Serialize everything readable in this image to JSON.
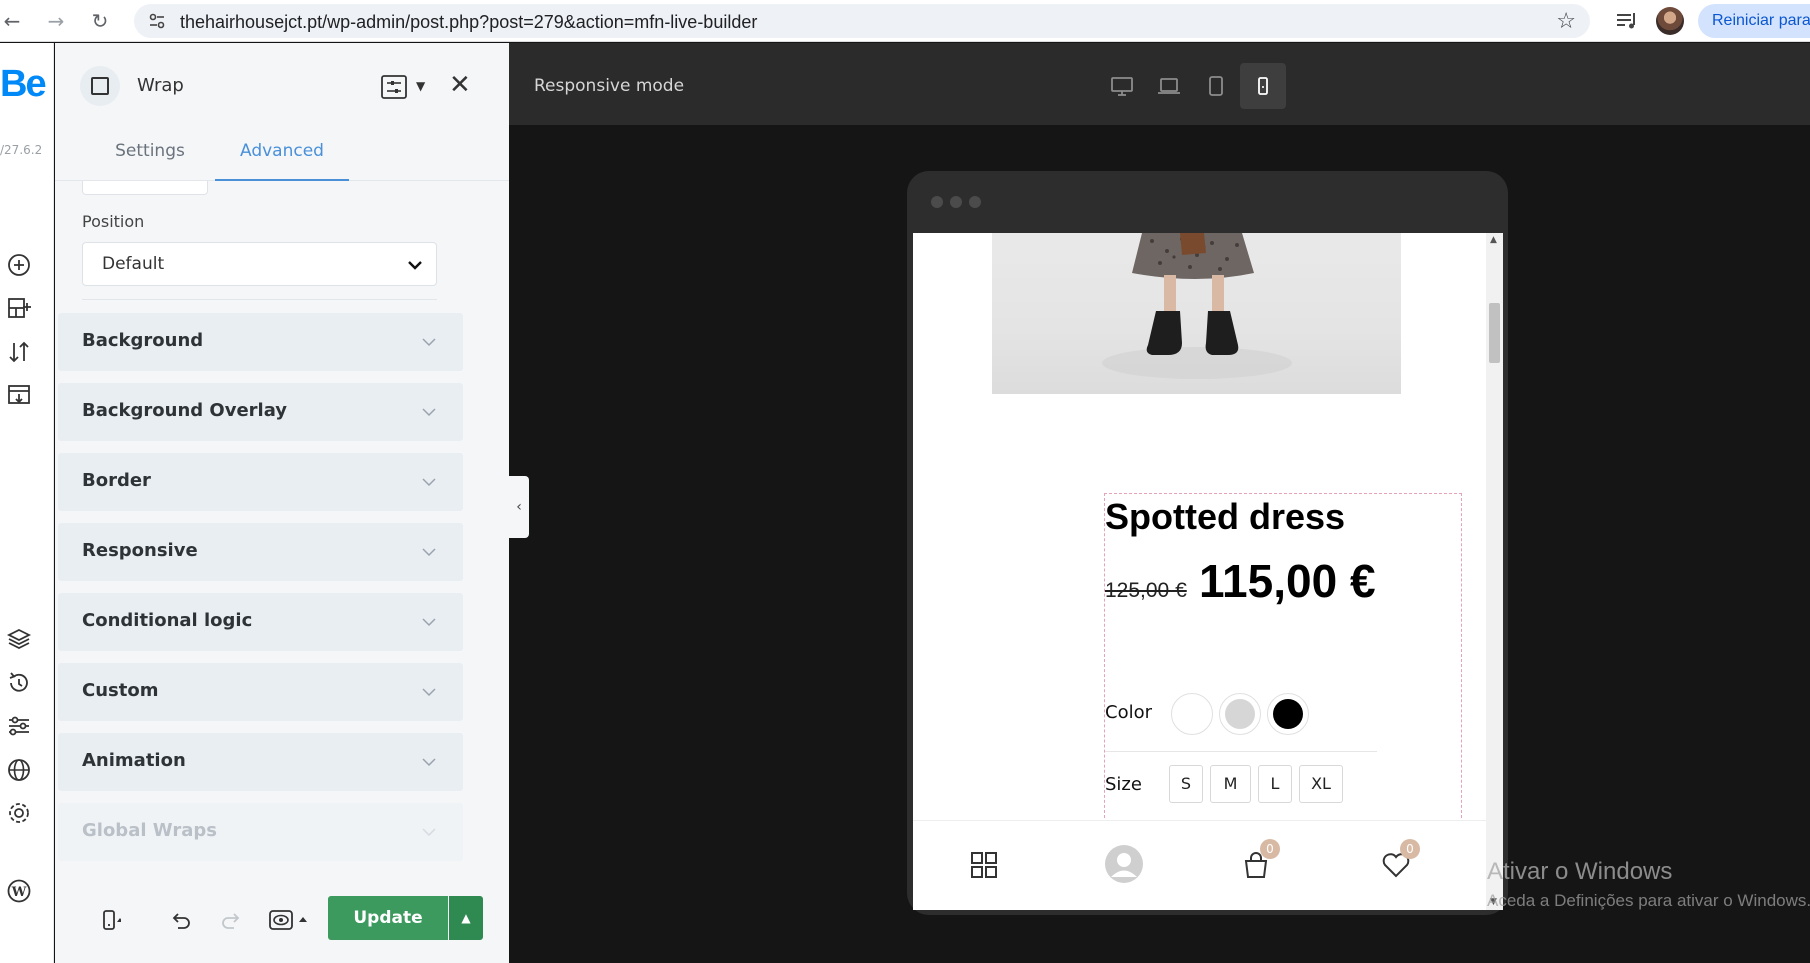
{
  "browser": {
    "url": "thehairhousejct.pt/wp-admin/post.php?post=279&action=mfn-live-builder",
    "reiniciar_label": "Reiniciar para a"
  },
  "rail": {
    "logo": "Be",
    "version": "/27.6.2"
  },
  "panel": {
    "title": "Wrap",
    "tabs": [
      {
        "label": "Settings",
        "active": false
      },
      {
        "label": "Advanced",
        "active": true
      }
    ],
    "position_label": "Position",
    "position_value": "Default",
    "sections": [
      {
        "label": "Background"
      },
      {
        "label": "Background Overlay"
      },
      {
        "label": "Border"
      },
      {
        "label": "Responsive"
      },
      {
        "label": "Conditional logic"
      },
      {
        "label": "Custom"
      },
      {
        "label": "Animation"
      },
      {
        "label": "Global Wraps"
      }
    ],
    "update_label": "Update"
  },
  "toolbar": {
    "mode_label": "Responsive mode",
    "devices": [
      "desktop",
      "laptop",
      "tablet",
      "mobile"
    ],
    "active_device": "mobile"
  },
  "preview": {
    "product_title": "Spotted dress",
    "old_price": "125,00 €",
    "price": "115,00 €",
    "color_label": "Color",
    "colors": [
      "#ffffff",
      "#d6d6d6",
      "#000000"
    ],
    "size_label": "Size",
    "sizes": [
      "S",
      "M",
      "L",
      "XL"
    ],
    "cart_count": "0",
    "wishlist_count": "0"
  },
  "watermark": {
    "line1": "Ativar o Windows",
    "line2": "Aceda a Definições para ativar o Windows."
  },
  "colors": {
    "accent": "#4a90d9",
    "update_green": "#3c9a5e",
    "toolbar_bg": "#2b2b2b",
    "canvas_bg": "#151515",
    "badge": "#d8b9a3"
  }
}
